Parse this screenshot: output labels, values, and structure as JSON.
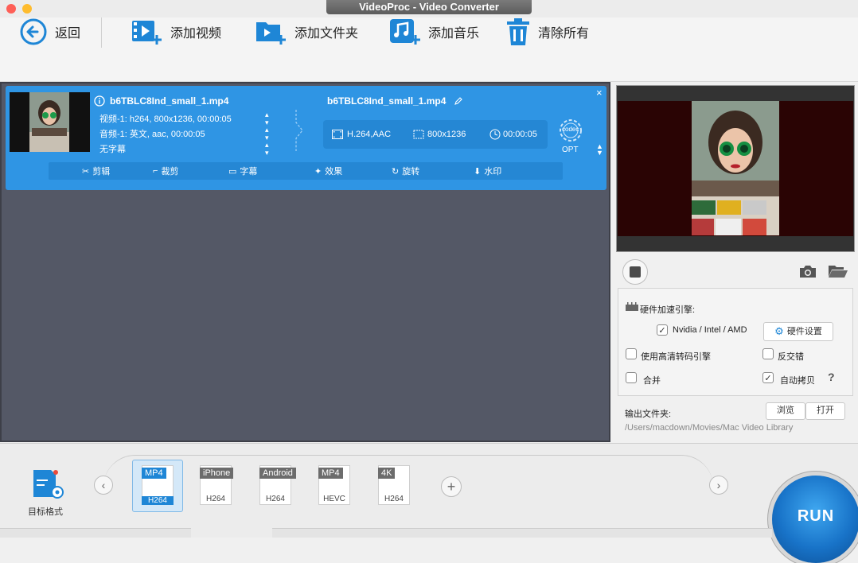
{
  "window": {
    "title": "VideoProc - Video Converter"
  },
  "toolbar": {
    "back": "返回",
    "add_video": "添加视频",
    "add_folder": "添加文件夹",
    "add_music": "添加音乐",
    "clear_all": "清除所有"
  },
  "item": {
    "source_name": "b6TBLC8Ind_small_1.mp4",
    "video_track": "视频-1: h264, 800x1236, 00:00:05",
    "audio_track": "音频-1: 英文, aac, 00:00:05",
    "subtitle": "无字幕",
    "output_name": "b6TBLC8Ind_small_1.mp4",
    "codec": "H.264,AAC",
    "resolution": "800x1236",
    "duration": "00:00:05",
    "codec_badge": "codec",
    "opt_label": "OPT",
    "edit": [
      "剪辑",
      "裁剪",
      "字幕",
      "效果",
      "旋转",
      "水印"
    ]
  },
  "settings": {
    "hw_title": "硬件加速引擎:",
    "nvidia_label": "Nvidia /  Intel / AMD",
    "nvidia_checked": true,
    "hw_settings_btn": "硬件设置",
    "hq_engine": "使用高清转码引擎",
    "deinterlace": "反交错",
    "merge": "合并",
    "autocopy": "自动拷贝",
    "autocopy_checked": true,
    "help": "?",
    "output_folder_label": "输出文件夹:",
    "browse_btn": "浏览",
    "open_btn": "打开",
    "output_path": "/Users/macdown/Movies/Mac Video Library"
  },
  "bottom": {
    "target_format": "目标格式",
    "formats": [
      {
        "top": "MP4",
        "bottom": "H264",
        "selected": true
      },
      {
        "top": "iPhone",
        "bottom": "H264",
        "selected": false
      },
      {
        "top": "Android",
        "bottom": "H264",
        "selected": false
      },
      {
        "top": "MP4",
        "bottom": "HEVC",
        "selected": false
      },
      {
        "top": "4K",
        "bottom": "H264",
        "selected": false
      }
    ],
    "run": "RUN"
  },
  "colors": {
    "accent": "#2f95e4",
    "panel": "#545866",
    "run": "#1a7bd0"
  }
}
